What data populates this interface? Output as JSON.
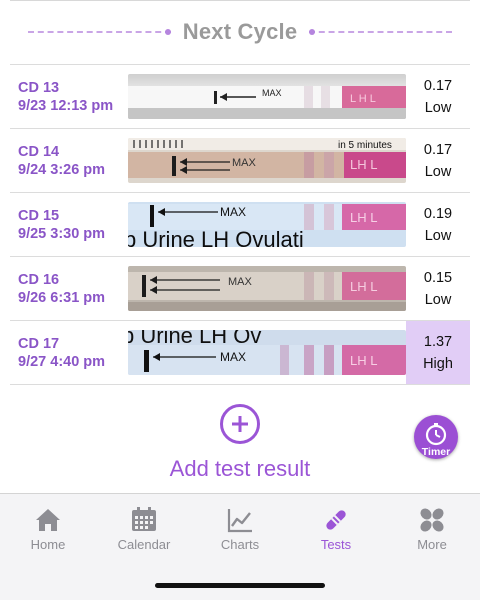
{
  "header": {
    "title": "Next Cycle"
  },
  "tests": [
    {
      "cd": "CD 13",
      "datetime": "9/23 12:13 pm",
      "value": "0.17",
      "level": "Low",
      "strip_text": "MAX"
    },
    {
      "cd": "CD 14",
      "datetime": "9/24 3:26 pm",
      "value": "0.17",
      "level": "Low",
      "strip_text": "MAX"
    },
    {
      "cd": "CD 15",
      "datetime": "9/25 3:30 pm",
      "value": "0.19",
      "level": "Low",
      "strip_text": "MAX"
    },
    {
      "cd": "CD 16",
      "datetime": "9/26 6:31 pm",
      "value": "0.15",
      "level": "Low",
      "strip_text": "MAX"
    },
    {
      "cd": "CD 17",
      "datetime": "9/27 4:40 pm",
      "value": "1.37",
      "level": "High",
      "strip_text": "MAX"
    }
  ],
  "add": {
    "label": "Add test result"
  },
  "timer": {
    "label": "Timer"
  },
  "tabbar": {
    "items": [
      {
        "label": "Home",
        "icon": "home-icon"
      },
      {
        "label": "Calendar",
        "icon": "calendar-icon"
      },
      {
        "label": "Charts",
        "icon": "chart-icon"
      },
      {
        "label": "Tests",
        "icon": "test-strip-icon"
      },
      {
        "label": "More",
        "icon": "more-icon"
      }
    ],
    "active": "Tests"
  },
  "colors": {
    "accent": "#9b55d6",
    "date_text": "#8a55c7",
    "high_bg": "#e1cdf6",
    "header_text": "#9a9a9a"
  }
}
